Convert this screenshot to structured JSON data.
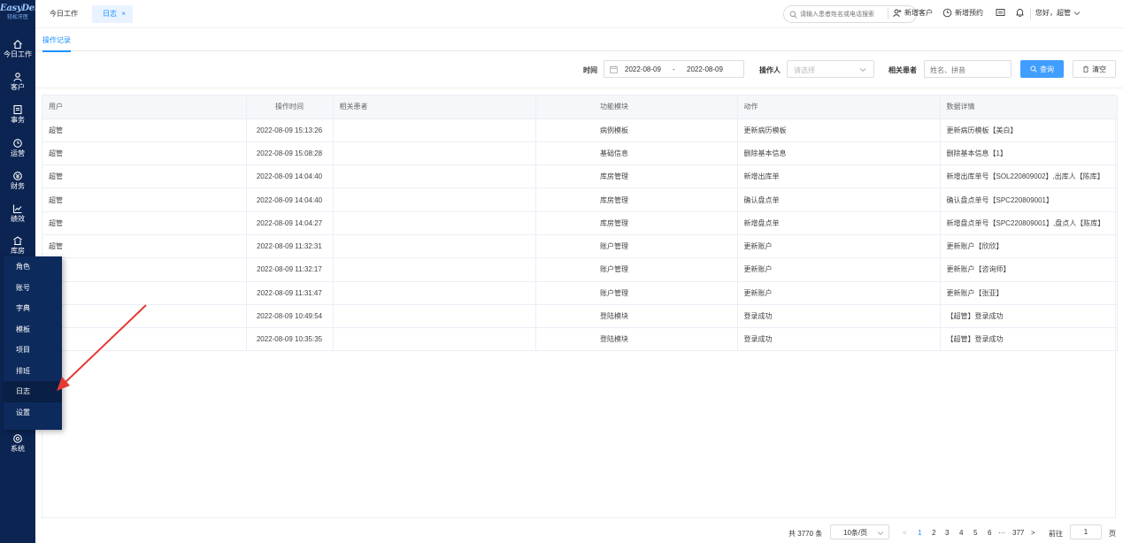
{
  "logo": {
    "main": "EasyDent",
    "sub": "轻松牙医"
  },
  "sidebar": {
    "items": [
      {
        "label": "今日工作",
        "icon": "home-icon"
      },
      {
        "label": "客户",
        "icon": "user-icon"
      },
      {
        "label": "事务",
        "icon": "notebook-icon"
      },
      {
        "label": "运营",
        "icon": "clock-icon"
      },
      {
        "label": "财务",
        "icon": "wallet-icon"
      },
      {
        "label": "绩效",
        "icon": "line-chart-icon"
      },
      {
        "label": "库房",
        "icon": "warehouse-icon"
      },
      {
        "label": "系统",
        "icon": "gear-icon"
      }
    ]
  },
  "submenu": {
    "items": [
      "角色",
      "账号",
      "字典",
      "模板",
      "项目",
      "排班",
      "日志",
      "设置"
    ],
    "active": "日志"
  },
  "header": {
    "tab_today": "今日工作",
    "tab_log": "日志",
    "tab_close": "×",
    "search_placeholder": "请输入患者姓名或电话搜索",
    "new_customer": "新增客户",
    "new_appointment": "新增预约",
    "greeting": "您好，超管"
  },
  "subtab": {
    "label": "操作记录"
  },
  "filters": {
    "time_label": "时间",
    "date_start": "2022-08-09",
    "date_sep": "-",
    "date_end": "2022-08-09",
    "operator_label": "操作人",
    "operator_placeholder": "请选择",
    "patient_label": "相关患者",
    "patient_placeholder": "姓名、拼音",
    "query_button": "查询",
    "clear_button": "清空"
  },
  "table": {
    "columns": [
      "用户",
      "操作时间",
      "相关患者",
      "功能模块",
      "动作",
      "数据详情"
    ],
    "rows": [
      [
        "超管",
        "2022-08-09 15:13:26",
        "",
        "病例模板",
        "更新病历模板",
        "更新病历模板【美白】"
      ],
      [
        "超管",
        "2022-08-09 15:08:28",
        "",
        "基础信息",
        "删除基本信息",
        "删除基本信息【1】"
      ],
      [
        "超管",
        "2022-08-09 14:04:40",
        "",
        "库房管理",
        "新增出库单",
        "新增出库单号【SOL220809002】,出库人【陈库】"
      ],
      [
        "超管",
        "2022-08-09 14:04:40",
        "",
        "库房管理",
        "确认盘点单",
        "确认盘点单号【SPC220809001】"
      ],
      [
        "超管",
        "2022-08-09 14:04:27",
        "",
        "库房管理",
        "新增盘点单",
        "新增盘点单号【SPC220809001】,盘点人【陈库】"
      ],
      [
        "超管",
        "2022-08-09 11:32:31",
        "",
        "账户管理",
        "更新账户",
        "更新账户【欣欣】"
      ],
      [
        "",
        "2022-08-09 11:32:17",
        "",
        "账户管理",
        "更新账户",
        "更新账户【咨询师】"
      ],
      [
        "",
        "2022-08-09 11:31:47",
        "",
        "账户管理",
        "更新账户",
        "更新账户【张亚】"
      ],
      [
        "",
        "2022-08-09 10:49:54",
        "",
        "登陆模块",
        "登录成功",
        "【超管】登录成功"
      ],
      [
        "",
        "2022-08-09 10:35:35",
        "",
        "登陆模块",
        "登录成功",
        "【超管】登录成功"
      ]
    ]
  },
  "pagination": {
    "total": "共 3770 条",
    "page_size": "10条/页",
    "prev": "<",
    "pages": [
      "1",
      "2",
      "3",
      "4",
      "5",
      "6",
      "···",
      "377"
    ],
    "next": ">",
    "goto_label": "前往",
    "goto_value": "1",
    "page_unit": "页"
  },
  "colors": {
    "sidebar_bg": "#0b2451",
    "accent": "#1890ff",
    "query_button": "#409eff",
    "annotation_arrow": "#e53935"
  }
}
